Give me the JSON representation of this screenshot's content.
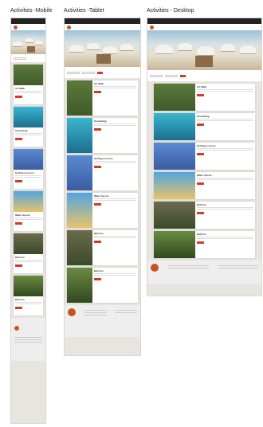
{
  "titles": {
    "mobile": "Activities -Mobile",
    "tablet": "Activities -Tablet",
    "desktop": "Activities - Desktop"
  },
  "colors": {
    "accent": "#d13b2b",
    "brand": "#c9531f"
  },
  "icons": {
    "brand_logo": "sun-logo-icon"
  },
  "activities": [
    {
      "title": "Art Walk",
      "image": "stone-statue-park"
    },
    {
      "title": "Snorkeling",
      "image": "underwater-diver"
    },
    {
      "title": "Surfing Lessons",
      "image": "surfboards-rack"
    },
    {
      "title": "Water Sports",
      "image": "waterpark"
    },
    {
      "title": "Bali Zoo",
      "image": "elephants"
    },
    {
      "title": "Bali Zoo",
      "image": "forest-animals"
    }
  ]
}
